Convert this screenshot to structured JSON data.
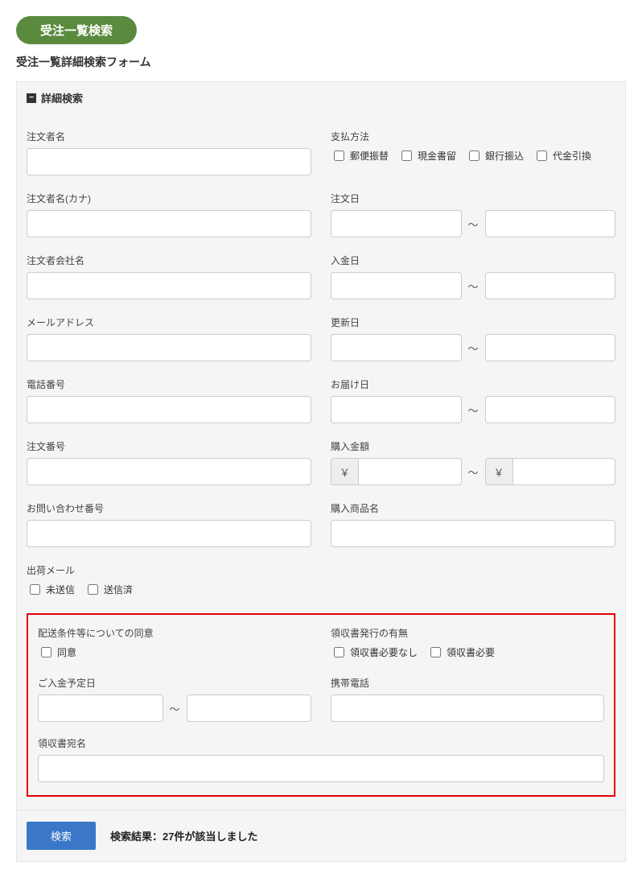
{
  "header": {
    "badge": "受注一覧検索",
    "subtitle": "受注一覧詳細検索フォーム"
  },
  "panel": {
    "title": "詳細検索"
  },
  "labels": {
    "orderer_name": "注文者名",
    "orderer_kana": "注文者名(カナ)",
    "orderer_company": "注文者会社名",
    "email": "メールアドレス",
    "phone": "電話番号",
    "order_no": "注文番号",
    "inquiry_no": "お問い合わせ番号",
    "ship_mail": "出荷メール",
    "pay_method": "支払方法",
    "order_date": "注文日",
    "payment_date": "入金日",
    "update_date": "更新日",
    "delivery_date": "お届け日",
    "purchase_amount": "購入金額",
    "product_name": "購入商品名",
    "delivery_consent": "配送条件等についての同意",
    "receipt_issue": "領収書発行の有無",
    "payment_schedule": "ご入金予定日",
    "mobile_phone": "携帯電話",
    "receipt_name": "領収書宛名"
  },
  "options": {
    "pay_methods": [
      "郵便振替",
      "現金書留",
      "銀行振込",
      "代金引換"
    ],
    "ship_mail": [
      "未送信",
      "送信済"
    ],
    "consent": [
      "同意"
    ],
    "receipt": [
      "領収書必要なし",
      "領収書必要"
    ]
  },
  "symbols": {
    "tilde": "～",
    "yen": "￥"
  },
  "footer": {
    "search_btn": "検索",
    "result": "検索結果：27件が該当しました"
  }
}
